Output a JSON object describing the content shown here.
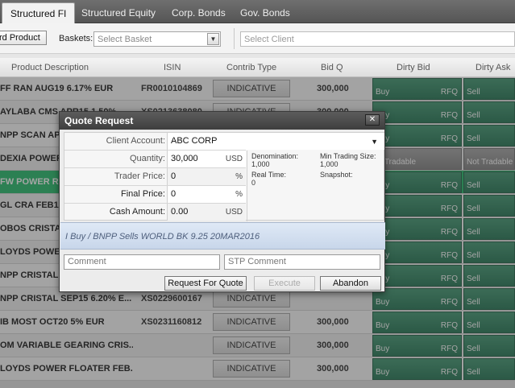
{
  "tabs": [
    {
      "label": "Structured FI",
      "active": true
    },
    {
      "label": "Structured Equity",
      "active": false
    },
    {
      "label": "Corp. Bonds",
      "active": false
    },
    {
      "label": "Gov. Bonds",
      "active": false
    }
  ],
  "toolbar": {
    "product_button": "rd Product",
    "baskets_label": "Baskets:",
    "basket_placeholder": "Select Basket",
    "client_placeholder": "Select Client"
  },
  "grid": {
    "headers": [
      "Product Description",
      "ISIN",
      "Contrib Type",
      "Bid Q",
      "Dirty Bid",
      "Dirty Ask"
    ],
    "rows": [
      {
        "desc": "FF RAN AUG19 6.17% EUR",
        "isin": "FR0010104869",
        "ctype": "INDICATIVE",
        "bidq": "300,000",
        "bid_l": "Buy",
        "bid_r": "RFQ",
        "ask": "Sell",
        "tradable": true
      },
      {
        "desc": "AYLABA CMS APR15 1.50% ...",
        "isin": "XS0213638080",
        "ctype": "INDICATIVE",
        "bidq": "300,000",
        "bid_l": "Buy",
        "bid_r": "RFQ",
        "ask": "Sell",
        "tradable": true
      },
      {
        "desc": "NPP SCAN APR...",
        "isin": "",
        "ctype": "",
        "bidq": "",
        "bid_l": "Buy",
        "bid_r": "RFQ",
        "ask": "Sell",
        "tradable": true
      },
      {
        "desc": "DEXIA POWER C...",
        "isin": "",
        "ctype": "",
        "bidq": "",
        "bid_l": "ot Tradable",
        "bid_r": "",
        "ask": "Not Tradable",
        "tradable": false
      },
      {
        "desc": "FW POWER RA...",
        "isin": "",
        "ctype": "",
        "bidq": "",
        "bid_l": "Buy",
        "bid_r": "RFQ",
        "ask": "Sell",
        "tradable": true
      },
      {
        "desc": "GL CRA FEB15",
        "isin": "",
        "ctype": "",
        "bidq": "",
        "bid_l": "Buy",
        "bid_r": "RFQ",
        "ask": "Sell",
        "tradable": true
      },
      {
        "desc": "OBOS CRISTAL...",
        "isin": "",
        "ctype": "",
        "bidq": "",
        "bid_l": "Buy",
        "bid_r": "RFQ",
        "ask": "Sell",
        "tradable": true
      },
      {
        "desc": "LOYDS POWER...",
        "isin": "",
        "ctype": "",
        "bidq": "",
        "bid_l": "Buy",
        "bid_r": "RFQ",
        "ask": "Sell",
        "tradable": true
      },
      {
        "desc": "NPP CRISTAL T...",
        "isin": "",
        "ctype": "",
        "bidq": "",
        "bid_l": "Buy",
        "bid_r": "RFQ",
        "ask": "Sell",
        "tradable": true
      },
      {
        "desc": "NPP CRISTAL SEP15 6.20% E...",
        "isin": "XS0229600167",
        "ctype": "INDICATIVE",
        "bidq": "",
        "bid_l": "Buy",
        "bid_r": "RFQ",
        "ask": "Sell",
        "tradable": true
      },
      {
        "desc": "IB MOST OCT20 5% EUR",
        "isin": "XS0231160812",
        "ctype": "INDICATIVE",
        "bidq": "300,000",
        "bid_l": "Buy",
        "bid_r": "RFQ",
        "ask": "Sell",
        "tradable": true
      },
      {
        "desc": "OM VARIABLE GEARING CRIS...",
        "isin": "",
        "ctype": "INDICATIVE",
        "bidq": "300,000",
        "bid_l": "Buy",
        "bid_r": "RFQ",
        "ask": "Sell",
        "tradable": true
      },
      {
        "desc": "LOYDS POWER FLOATER FEB...",
        "isin": "",
        "ctype": "INDICATIVE",
        "bidq": "300,000",
        "bid_l": "Buy",
        "bid_r": "RFQ",
        "ask": "Sell",
        "tradable": true
      }
    ]
  },
  "dialog": {
    "title": "Quote Request",
    "close": "✕",
    "client_label": "Client Account:",
    "client_value": "ABC CORP",
    "quantity_label": "Quantity:",
    "quantity_value": "30,000",
    "quantity_unit": "USD",
    "trader_price_label": "Trader Price:",
    "trader_price_value": "0",
    "trader_price_unit": "%",
    "final_price_label": "Final Price:",
    "final_price_value": "0",
    "final_price_unit": "%",
    "cash_label": "Cash Amount:",
    "cash_value": "0.00",
    "cash_unit": "USD",
    "denomination_label": "Denomination:",
    "denomination_value": "1,000",
    "min_trading_label": "Min Trading Size:",
    "min_trading_value": "1,000",
    "realtime_label": "Real Time:",
    "realtime_value": "0",
    "snapshot_label": "Snapshot:",
    "summary": "I Buy / BNPP Sells  WORLD BK 9.25 20MAR2016",
    "comment_placeholder": "Comment",
    "stp_comment_placeholder": "STP Comment",
    "request_button": "Request For Quote",
    "execute_button": "Execute",
    "abandon_button": "Abandon"
  }
}
